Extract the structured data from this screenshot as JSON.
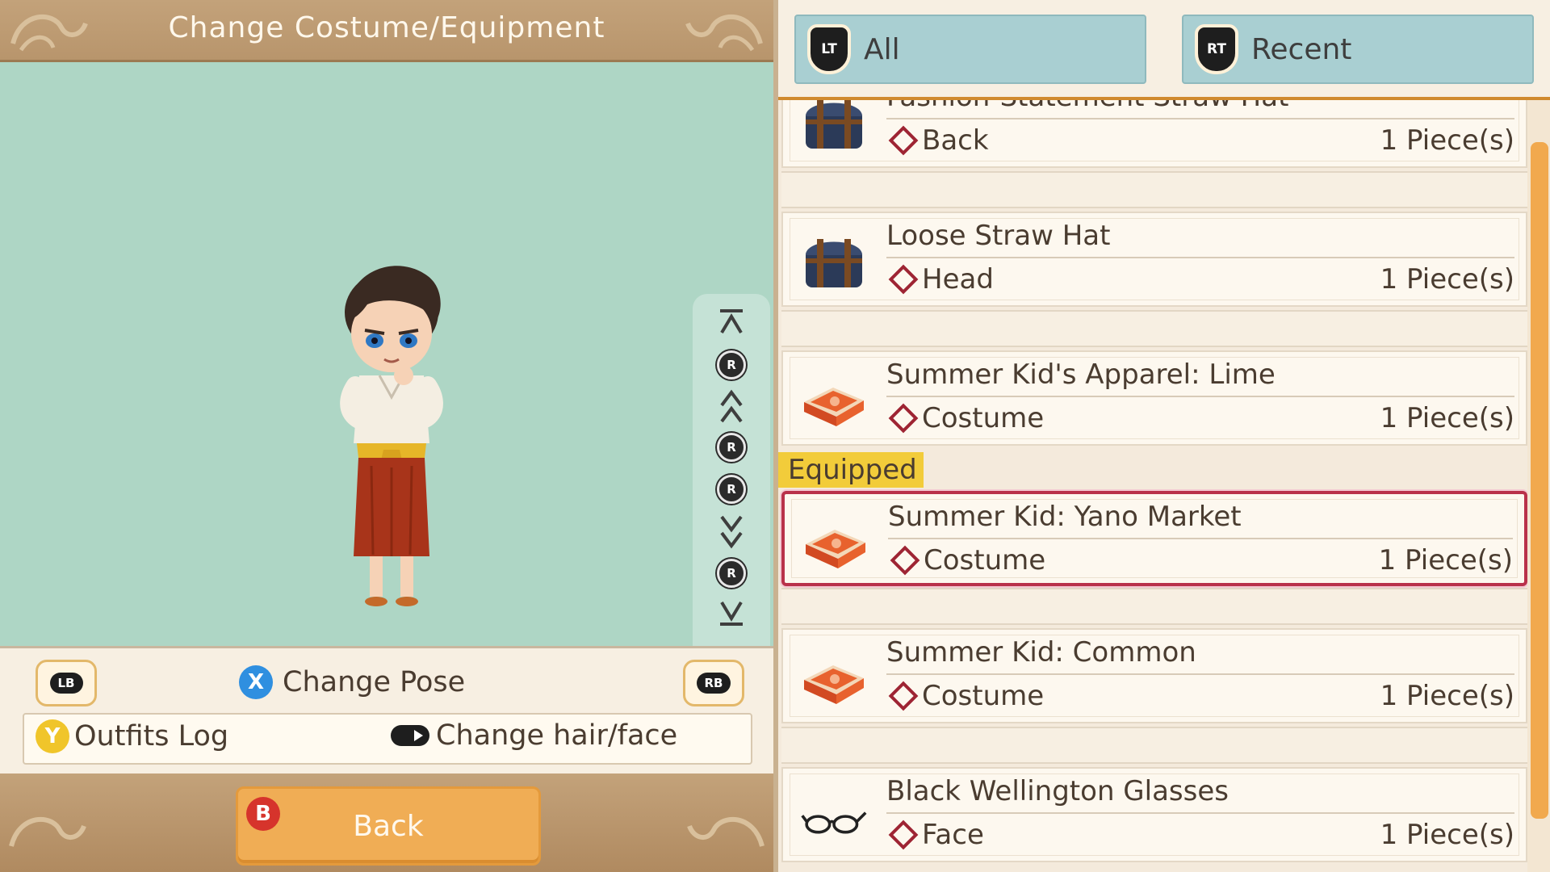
{
  "left_panel": {
    "title": "Change Costume/Equipment",
    "controls": {
      "lb": "LB",
      "rb": "RB",
      "x_glyph": "X",
      "change_pose": "Change Pose",
      "y_glyph": "Y",
      "outfits_log": "Outfits Log",
      "change_hair_face": "Change hair/face"
    },
    "rotate_glyph": "R",
    "footer": {
      "b_glyph": "B",
      "back_label": "Back"
    }
  },
  "right_panel": {
    "tabs": [
      {
        "trigger": "LT",
        "label": "All"
      },
      {
        "trigger": "RT",
        "label": "Recent"
      }
    ],
    "items": [
      {
        "name": "Fashion-Statement Straw Hat",
        "slot": "Back",
        "qty": "1 Piece(s)",
        "icon": "chest-icon"
      },
      {
        "name": "Loose Straw Hat",
        "slot": "Head",
        "qty": "1 Piece(s)",
        "icon": "chest-icon"
      },
      {
        "name": "Summer Kid's Apparel: Lime",
        "slot": "Costume",
        "qty": "1 Piece(s)",
        "icon": "costume-box-icon"
      },
      {
        "name": "Summer Kid: Yano Market",
        "slot": "Costume",
        "qty": "1 Piece(s)",
        "icon": "costume-box-icon"
      },
      {
        "name": "Summer Kid: Common",
        "slot": "Costume",
        "qty": "1 Piece(s)",
        "icon": "costume-box-icon"
      },
      {
        "name": "Black Wellington Glasses",
        "slot": "Face",
        "qty": "1 Piece(s)",
        "icon": "glasses-icon"
      }
    ],
    "equipped_label": "Equipped"
  },
  "colors": {
    "accent_orange": "#f0ad55",
    "selection": "#b9314a",
    "preview_bg": "#aed6c5",
    "tab_bg": "#a9cfd2"
  }
}
